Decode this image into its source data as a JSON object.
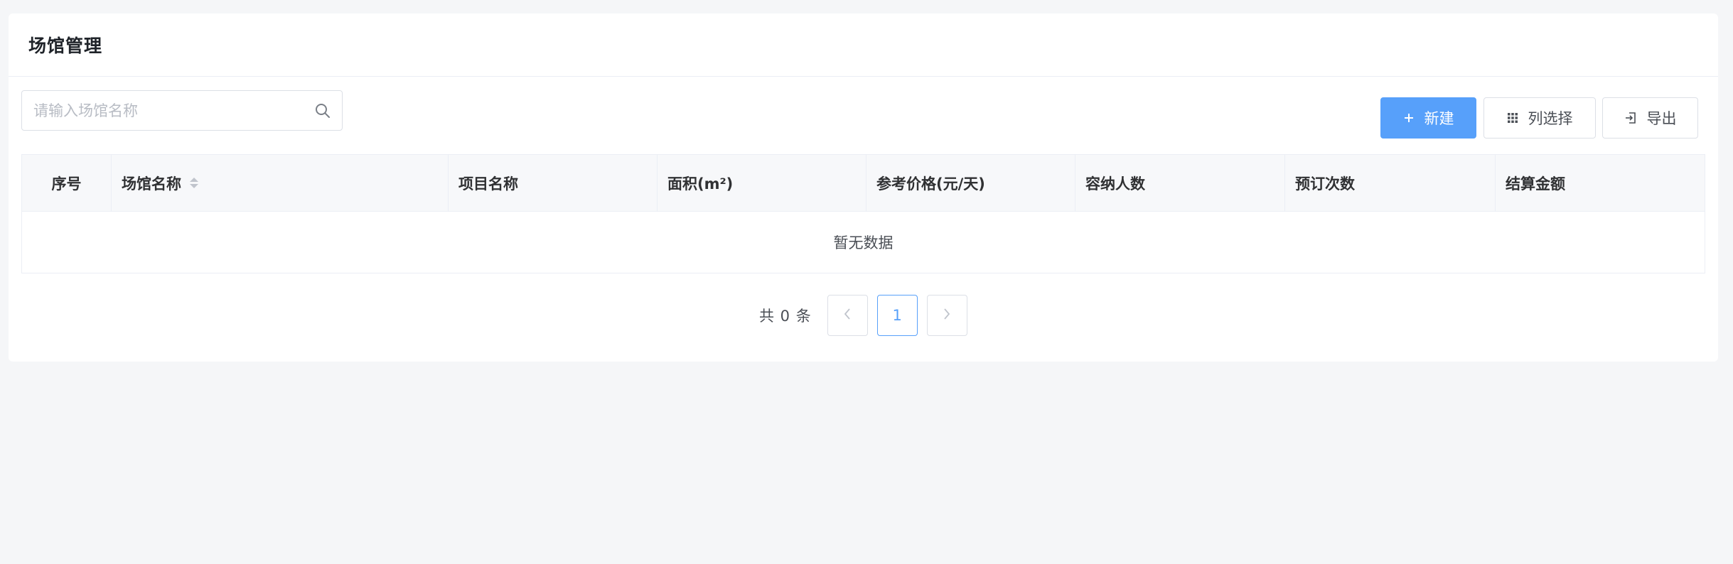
{
  "page": {
    "title": "场馆管理"
  },
  "search": {
    "placeholder": "请输入场馆名称",
    "value": ""
  },
  "toolbar": {
    "new_label": "新建",
    "columns_label": "列选择",
    "export_label": "导出"
  },
  "table": {
    "columns": [
      {
        "label": "序号"
      },
      {
        "label": "场馆名称",
        "sortable": true
      },
      {
        "label": "项目名称"
      },
      {
        "label": "面积(m²)"
      },
      {
        "label": "参考价格(元/天)"
      },
      {
        "label": "容纳人数"
      },
      {
        "label": "预订次数"
      },
      {
        "label": "结算金额"
      }
    ],
    "empty_text": "暂无数据"
  },
  "pagination": {
    "total_text": "共 0 条",
    "current_page": "1"
  },
  "colors": {
    "primary": "#57a0fa",
    "background": "#f5f6f8",
    "border": "#dcdfe6"
  }
}
